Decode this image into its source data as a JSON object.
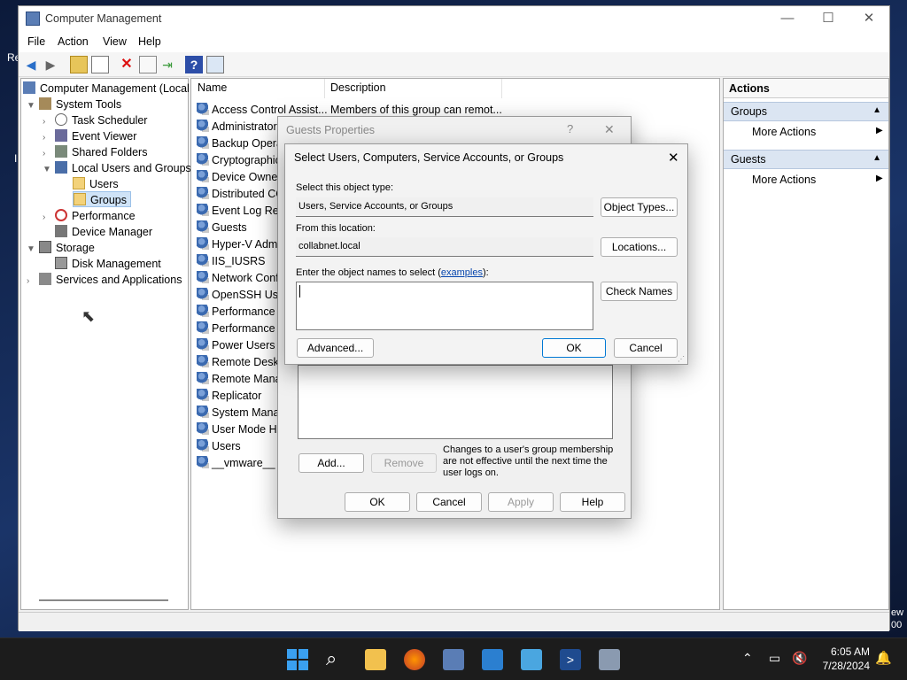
{
  "desktop": {
    "frag1": "Re",
    "frag2": "I",
    "frag3": "ew",
    "frag4": "00"
  },
  "window": {
    "title": "Computer Management",
    "minimize": "—",
    "maximize": "☐",
    "close": "✕"
  },
  "menubar": [
    "File",
    "Action",
    "View",
    "Help"
  ],
  "tree": {
    "root": "Computer Management (Local",
    "system_tools": "System Tools",
    "task_scheduler": "Task Scheduler",
    "event_viewer": "Event Viewer",
    "shared_folders": "Shared Folders",
    "local_users_groups": "Local Users and Groups",
    "users": "Users",
    "groups": "Groups",
    "performance": "Performance",
    "device_manager": "Device Manager",
    "storage": "Storage",
    "disk_management": "Disk Management",
    "services_apps": "Services and Applications"
  },
  "list": {
    "col_name": "Name",
    "col_desc": "Description",
    "rows": [
      {
        "name": "Access Control Assist...",
        "desc": "Members of this group can remot..."
      },
      {
        "name": "Administrators"
      },
      {
        "name": "Backup Operat"
      },
      {
        "name": "Cryptographic"
      },
      {
        "name": "Device Owners"
      },
      {
        "name": "Distributed CC"
      },
      {
        "name": "Event Log Rea"
      },
      {
        "name": "Guests"
      },
      {
        "name": "Hyper-V Admi"
      },
      {
        "name": "IIS_IUSRS"
      },
      {
        "name": "Network Confi"
      },
      {
        "name": "OpenSSH User"
      },
      {
        "name": "Performance L"
      },
      {
        "name": "Performance M"
      },
      {
        "name": "Power Users"
      },
      {
        "name": "Remote Deskto"
      },
      {
        "name": "Remote Manag"
      },
      {
        "name": "Replicator"
      },
      {
        "name": "System Manag"
      },
      {
        "name": "User Mode Ha"
      },
      {
        "name": "Users"
      },
      {
        "name": "__vmware__"
      }
    ]
  },
  "actions": {
    "header": "Actions",
    "section1": "Groups",
    "section2": "Guests",
    "more": "More Actions"
  },
  "guests_dialog": {
    "title": "Guests Properties",
    "help": "?",
    "close": "✕",
    "add": "Add...",
    "remove": "Remove",
    "note": "Changes to a user's group membership are not effective until the next time the user logs on.",
    "ok": "OK",
    "cancel": "Cancel",
    "apply": "Apply",
    "help_btn": "Help"
  },
  "select_dialog": {
    "title": "Select Users, Computers, Service Accounts, or Groups",
    "close": "✕",
    "object_type_label": "Select this object type:",
    "object_type_value": "Users, Service Accounts, or Groups",
    "object_types_btn": "Object Types...",
    "location_label": "From this location:",
    "location_value": "collabnet.local",
    "locations_btn": "Locations...",
    "names_label": "Enter the object names to select (",
    "examples_link": "examples",
    "names_label_end": "):",
    "names_value": "",
    "check_names_btn": "Check Names",
    "advanced_btn": "Advanced...",
    "ok": "OK",
    "cancel": "Cancel"
  },
  "taskbar": {
    "time": "6:05 AM",
    "date": "7/28/2024"
  }
}
